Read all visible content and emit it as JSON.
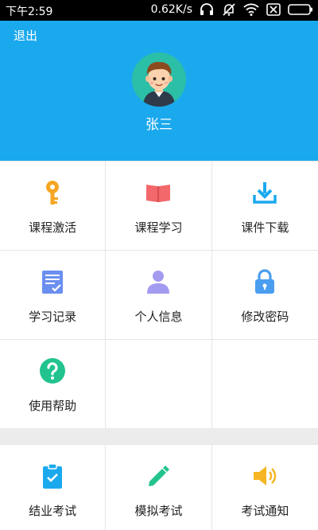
{
  "status_bar": {
    "time": "下午2:59",
    "speed": "0.62K/s"
  },
  "header": {
    "logout_label": "退出",
    "username": "张三",
    "bg_color": "#1ba9ee"
  },
  "menu_main": [
    {
      "label": "课程激活",
      "icon": "key-icon"
    },
    {
      "label": "课程学习",
      "icon": "book-icon"
    },
    {
      "label": "课件下载",
      "icon": "download-icon"
    },
    {
      "label": "学习记录",
      "icon": "checklist-icon"
    },
    {
      "label": "个人信息",
      "icon": "person-icon"
    },
    {
      "label": "修改密码",
      "icon": "lock-icon"
    },
    {
      "label": "使用帮助",
      "icon": "help-icon"
    }
  ],
  "menu_exam": [
    {
      "label": "结业考试",
      "icon": "clipboard-check-icon"
    },
    {
      "label": "模拟考试",
      "icon": "pencil-icon"
    },
    {
      "label": "考试通知",
      "icon": "speaker-icon"
    }
  ]
}
